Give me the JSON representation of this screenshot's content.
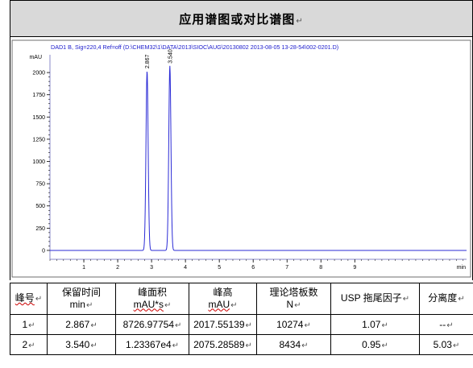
{
  "page": {
    "title": "应用谱图或对比谱图",
    "para_mark": "↵"
  },
  "chart_data": {
    "type": "line",
    "header": "DAD1 B, Sig=220,4 Ref=off (D:\\CHEM32\\1\\DATA\\2013\\SIOC\\AUG\\20130802 2013-08-05 13-28-54\\002-0201.D)",
    "ylabel": "mAU",
    "xlabel": "min",
    "xlim": [
      0,
      12.3
    ],
    "ylim": [
      -100,
      2200
    ],
    "x_ticks": [
      1,
      2,
      3,
      4,
      5,
      6,
      7,
      8,
      9
    ],
    "x_tick_labels": [
      "1",
      "2",
      "3",
      "4",
      "5",
      "6",
      "7",
      "8",
      "9"
    ],
    "y_ticks": [
      0,
      250,
      500,
      750,
      1000,
      1250,
      1500,
      1750,
      2000
    ],
    "y_tick_labels": [
      "0",
      "250",
      "500",
      "750",
      "1000",
      "1250",
      "1500",
      "1750",
      "2000"
    ],
    "peaks": [
      {
        "rt": 2.867,
        "height": 2017.55139,
        "label": "2.867"
      },
      {
        "rt": 3.54,
        "height": 2075.28589,
        "label": "3.540"
      }
    ],
    "line_color": "#2b2bd6",
    "axis_color": "#8a8ac8"
  },
  "table": {
    "headers": [
      {
        "line1": "峰号",
        "line2": "",
        "wavy": true
      },
      {
        "line1": "保留时间",
        "line2": "min",
        "wavy": false
      },
      {
        "line1": "峰面积",
        "line2": "mAU*s",
        "wavy": true
      },
      {
        "line1": "峰高",
        "line2": "mAU",
        "wavy": true
      },
      {
        "line1": "理论塔板数",
        "line2": "N",
        "wavy": false
      },
      {
        "line1": "USP 拖尾因子",
        "line2": "",
        "wavy": false
      },
      {
        "line1": "分离度",
        "line2": "",
        "wavy": false
      }
    ],
    "rows": [
      [
        "1",
        "2.867",
        "8726.97754",
        "2017.55139",
        "10274",
        "1.07",
        "--"
      ],
      [
        "2",
        "3.540",
        "1.23367e4",
        "2075.28589",
        "8434",
        "0.95",
        "5.03"
      ]
    ]
  }
}
